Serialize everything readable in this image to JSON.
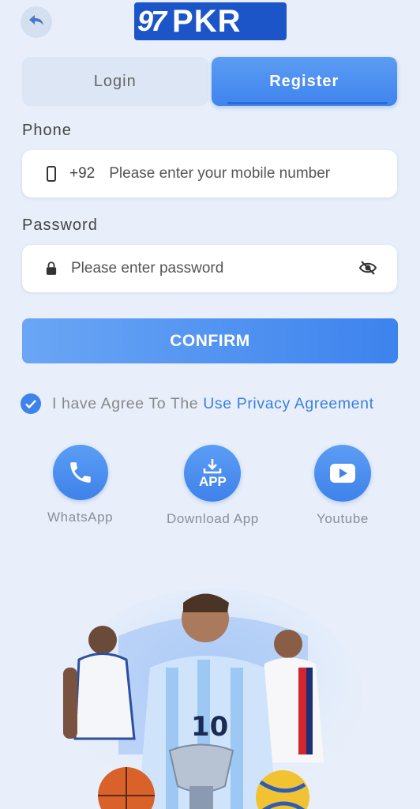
{
  "header": {
    "back_icon": "back-arrow-icon",
    "logo_number": "97",
    "logo_text": "PKR"
  },
  "tabs": [
    {
      "label": "Login",
      "active": false
    },
    {
      "label": "Register",
      "active": true
    }
  ],
  "form": {
    "phone_label": "Phone",
    "phone_icon": "mobile-phone-icon",
    "country_code": "+92",
    "phone_placeholder": "Please enter your mobile number",
    "password_label": "Password",
    "password_icon": "lock-icon",
    "password_placeholder": "Please enter password",
    "visibility_icon": "eye-off-icon",
    "confirm_label": "CONFIRM"
  },
  "agreement": {
    "checked": true,
    "text": "I have Agree To The",
    "link": "Use Privacy Agreement"
  },
  "quick_links": [
    {
      "label": "WhatsApp",
      "icon": "phone-icon"
    },
    {
      "label": "Download App",
      "icon": "download-app-icon",
      "icon_text": "APP"
    },
    {
      "label": "Youtube",
      "icon": "youtube-play-icon"
    }
  ],
  "colors": {
    "background": "#e8effa",
    "accent": "#3f84ee",
    "link": "#3b7fe0"
  }
}
